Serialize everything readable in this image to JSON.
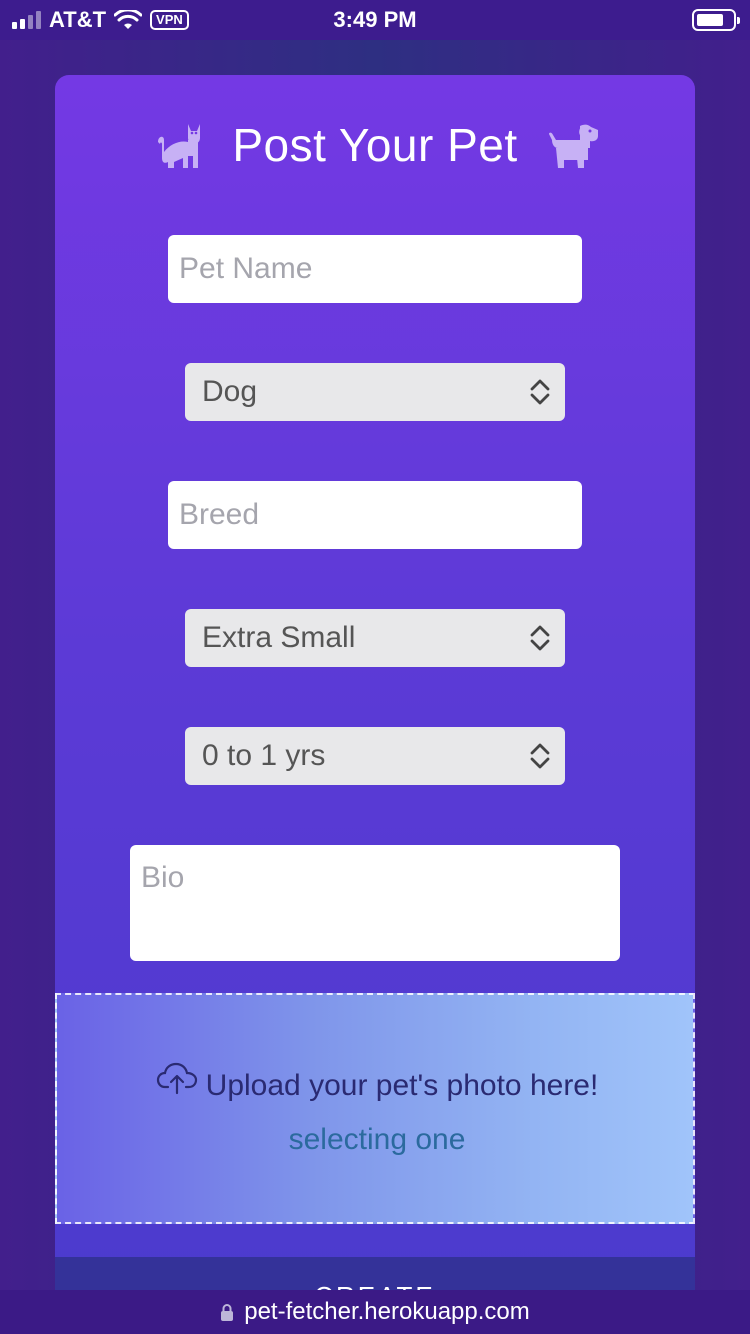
{
  "status_bar": {
    "carrier": "AT&T",
    "vpn_label": "VPN",
    "time": "3:49 PM"
  },
  "form": {
    "title": "Post Your Pet",
    "pet_name": {
      "placeholder": "Pet Name",
      "value": ""
    },
    "species": {
      "selected": "Dog"
    },
    "breed": {
      "placeholder": "Breed",
      "value": ""
    },
    "size": {
      "selected": "Extra Small"
    },
    "age": {
      "selected": "0 to 1 yrs"
    },
    "bio": {
      "placeholder": "Bio",
      "value": ""
    },
    "upload": {
      "prompt": "Upload your pet's photo here!",
      "link": "selecting one"
    },
    "submit_label": "CREATE"
  },
  "browser": {
    "url": "pet-fetcher.herokuapp.com"
  },
  "colors": {
    "accent": "#7439e4",
    "icon_tint": "#c7b1f5"
  }
}
